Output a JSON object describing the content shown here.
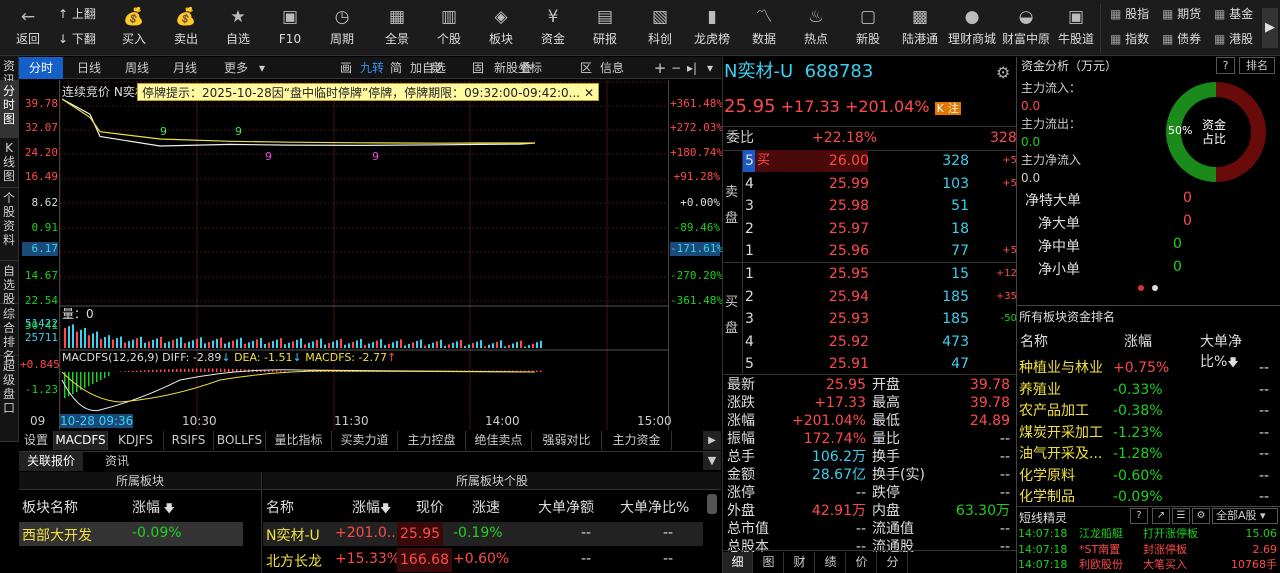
{
  "toolbar": {
    "back": "返回",
    "up": "上翻",
    "down": "下翻",
    "buttons": [
      {
        "label": "买入",
        "icon": "money-bag-icon"
      },
      {
        "label": "卖出",
        "icon": "money-bag-icon"
      },
      {
        "label": "自选",
        "icon": "star-icon"
      },
      {
        "label": "F10",
        "icon": "f10-icon"
      },
      {
        "label": "周期",
        "icon": "clock-icon"
      },
      {
        "label": "全景",
        "icon": "grid-icon"
      },
      {
        "label": "个股",
        "icon": "candlestick-icon"
      },
      {
        "label": "板块",
        "icon": "layers-icon"
      },
      {
        "label": "资金",
        "icon": "yen-icon"
      },
      {
        "label": "研报",
        "icon": "document-icon"
      },
      {
        "label": "科创",
        "icon": "chart-icon"
      },
      {
        "label": "龙虎榜",
        "icon": "bar-chart-icon"
      },
      {
        "label": "数据",
        "icon": "line-chart-icon"
      },
      {
        "label": "热点",
        "icon": "flame-icon"
      },
      {
        "label": "新股",
        "icon": "ipo-icon"
      },
      {
        "label": "陆港通",
        "icon": "lu-icon"
      },
      {
        "label": "理财商城",
        "icon": "shop-icon"
      },
      {
        "label": "财富中原",
        "icon": "bull-icon"
      },
      {
        "label": "牛股道",
        "icon": "niu-icon"
      }
    ],
    "right_items": [
      "股指",
      "期货",
      "基金",
      "指数",
      "债券",
      "港股"
    ]
  },
  "left_side_tabs": [
    "资讯",
    "分时图",
    "K线图",
    "个股资料",
    "自选股",
    "综合排名",
    "超级盘口"
  ],
  "chart_tabs": {
    "items": [
      "分时",
      "日线",
      "周线",
      "月线",
      "更多"
    ],
    "active": "分时",
    "tools": [
      "画",
      "九转",
      "简",
      "加自选",
      "竞",
      "固",
      "新股坐标",
      "叠",
      "区",
      "信息"
    ]
  },
  "chart": {
    "title_label": "连续竞价",
    "stock_short": "N奕材",
    "notice": "停牌提示：2025-10-28因“盘中临时停牌”停牌，停牌期限：09:32:00-09:42:0...",
    "y_left": [
      "39.78",
      "32.07",
      "24.20",
      "16.49",
      "8.62",
      "0.91",
      "6.17",
      "14.67",
      "22.54",
      "30.41"
    ],
    "y_right": [
      "+361.48%",
      "+272.03%",
      "+180.74%",
      "+91.28%",
      "+0.00%",
      "-89.46%",
      "-171.61%",
      "-270.20%",
      "-361.48%"
    ],
    "volume_label": "量：0",
    "vol_axis": [
      "51422",
      "25711"
    ],
    "macd_label": "MACDFS(12,26,9)",
    "diff": "DIFF: -2.89",
    "dea": "DEA: -1.51",
    "macdfs": "MACDFS: -2.77",
    "macd_axis": [
      "+0.845",
      "-1.23"
    ],
    "x_axis": [
      "09",
      "10-28 09:36",
      "10:30",
      "11:30",
      "14:00",
      "15:00"
    ],
    "markers": [
      "9",
      "9",
      "9",
      "9"
    ],
    "bottom_tabs": [
      "设置",
      "MACDFS",
      "KDJFS",
      "RSIFS",
      "BOLLFS",
      "量比指标",
      "买卖力道",
      "主力控盘",
      "绝佳卖点",
      "强弱对比",
      "主力资金"
    ]
  },
  "chart_data": {
    "type": "line",
    "series": [
      {
        "values": [
          39.78,
          35.0,
          28.0,
          25.0,
          25.5,
          25.3,
          25.2,
          25.4,
          25.5,
          25.6,
          25.95
        ]
      },
      {
        "values": [
          39.78,
          34.0,
          29.5,
          27.2,
          26.5,
          26.2,
          26.0,
          25.9,
          25.95,
          25.95,
          25.95
        ]
      }
    ]
  },
  "related": {
    "tabs": [
      "关联报价",
      "资讯"
    ],
    "sector_header": "所属板块",
    "sector_cols": [
      "板块名称",
      "涨幅"
    ],
    "sectors": [
      {
        "name": "西部大开发",
        "pct": "-0.09%"
      }
    ],
    "stocks_header": "所属板块个股",
    "stock_cols": [
      "名称",
      "涨幅",
      "现价",
      "涨速",
      "大单净额",
      "大单净比%"
    ],
    "stocks": [
      {
        "name": "N奕材-U",
        "pct": "+201.0...",
        "price": "25.95",
        "speed": "-0.19%",
        "net": "--",
        "ratio": "--"
      },
      {
        "name": "北方长龙",
        "pct": "+15.33%",
        "price": "166.68",
        "speed": "+0.60%",
        "net": "--",
        "ratio": "--"
      }
    ]
  },
  "quote": {
    "name": "N奕材-U",
    "code": "688783",
    "price": "25.95",
    "change": "+17.33",
    "pct": "+201.04%",
    "k_badge": "K",
    "zhu_badge": "注",
    "weibi_label": "委比",
    "weibi": "+22.18%",
    "weicha": "328",
    "sell_side": "卖盘",
    "buy_side": "买盘",
    "sells": [
      {
        "lvl": "5",
        "price": "26.00",
        "vol": "328",
        "chg": "+5",
        "mark": "买"
      },
      {
        "lvl": "4",
        "price": "25.99",
        "vol": "103",
        "chg": "+5",
        "mark": ""
      },
      {
        "lvl": "3",
        "price": "25.98",
        "vol": "51",
        "chg": "",
        "mark": ""
      },
      {
        "lvl": "2",
        "price": "25.97",
        "vol": "18",
        "chg": "",
        "mark": ""
      },
      {
        "lvl": "1",
        "price": "25.96",
        "vol": "77",
        "chg": "+5",
        "mark": ""
      }
    ],
    "buys": [
      {
        "lvl": "1",
        "price": "25.95",
        "vol": "15",
        "chg": "+12"
      },
      {
        "lvl": "2",
        "price": "25.94",
        "vol": "185",
        "chg": "+35"
      },
      {
        "lvl": "3",
        "price": "25.93",
        "vol": "185",
        "chg": "-50"
      },
      {
        "lvl": "4",
        "price": "25.92",
        "vol": "473",
        "chg": ""
      },
      {
        "lvl": "5",
        "price": "25.91",
        "vol": "47",
        "chg": ""
      }
    ],
    "stats": [
      {
        "l1": "最新",
        "v1": "25.95",
        "c1": "red",
        "l2": "开盘",
        "v2": "39.78",
        "c2": "red"
      },
      {
        "l1": "涨跌",
        "v1": "+17.33",
        "c1": "red",
        "l2": "最高",
        "v2": "39.78",
        "c2": "red"
      },
      {
        "l1": "涨幅",
        "v1": "+201.04%",
        "c1": "red",
        "l2": "最低",
        "v2": "24.89",
        "c2": "red"
      },
      {
        "l1": "振幅",
        "v1": "172.74%",
        "c1": "red",
        "l2": "量比",
        "v2": "--",
        "c2": "white"
      },
      {
        "l1": "总手",
        "v1": "106.2万",
        "c1": "cyan",
        "l2": "换手",
        "v2": "--",
        "c2": "white"
      },
      {
        "l1": "金额",
        "v1": "28.67亿",
        "c1": "cyan",
        "l2": "换手(实)",
        "v2": "--",
        "c2": "white"
      },
      {
        "l1": "涨停",
        "v1": "--",
        "c1": "white",
        "l2": "跌停",
        "v2": "--",
        "c2": "white"
      },
      {
        "l1": "外盘",
        "v1": "42.91万",
        "c1": "red",
        "l2": "内盘",
        "v2": "63.30万",
        "c2": "green"
      },
      {
        "l1": "总市值",
        "v1": "--",
        "c1": "white",
        "l2": "流通值",
        "v2": "--",
        "c2": "white"
      },
      {
        "l1": "总股本",
        "v1": "--",
        "c1": "white",
        "l2": "流通股",
        "v2": "--",
        "c2": "white"
      }
    ],
    "bottom_tabs": [
      "细",
      "图",
      "财",
      "绩",
      "价",
      "分"
    ]
  },
  "funds": {
    "title": "资金分析（万元）",
    "help": "?",
    "rank": "排名",
    "inflow_label": "主力流入：",
    "inflow": "0.0",
    "outflow_label": "主力流出：",
    "outflow": "0.0",
    "net_label": "主力净流入",
    "net": "0.0",
    "pie_pct": "50%",
    "pie_label1": "资金",
    "pie_label2": "占比",
    "details": [
      {
        "label": "净特大单",
        "value": "0"
      },
      {
        "label": "净大单",
        "value": "0"
      },
      {
        "label": "净中单",
        "value": "0"
      },
      {
        "label": "净小单",
        "value": "0"
      }
    ],
    "rank_title": "所有板块资金排名",
    "rank_cols": [
      "名称",
      "涨幅",
      "大单净比%"
    ],
    "rank_rows": [
      {
        "name": "种植业与林业",
        "pct": "+0.75%",
        "v": "--"
      },
      {
        "name": "养殖业",
        "pct": "-0.33%",
        "v": "--"
      },
      {
        "name": "农产品加工",
        "pct": "-0.38%",
        "v": "--"
      },
      {
        "name": "煤炭开采加工",
        "pct": "-1.23%",
        "v": "--"
      },
      {
        "name": "油气开采及...",
        "pct": "-1.28%",
        "v": "--"
      },
      {
        "name": "化学原料",
        "pct": "-0.60%",
        "v": "--"
      },
      {
        "name": "化学制品",
        "pct": "-0.09%",
        "v": "--"
      }
    ],
    "sprite_title": "短线精灵",
    "sprite_filter": "全部A股",
    "sprites": [
      {
        "time": "14:07:18",
        "name": "江龙船艇",
        "event": "打开涨停板",
        "val": "15.06"
      },
      {
        "time": "14:07:18",
        "name": "*ST南置",
        "event": "封涨停板",
        "val": "2.69"
      },
      {
        "time": "14:07:18",
        "name": "利欧股份",
        "event": "大笔买入",
        "val": "10768手"
      }
    ]
  }
}
